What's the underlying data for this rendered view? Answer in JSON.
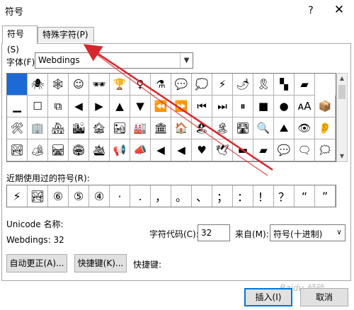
{
  "dialog": {
    "title": "符号",
    "help": "?",
    "close": "✕"
  },
  "tabs": [
    {
      "label": "符号(S)"
    },
    {
      "label": "特殊字符(P)"
    }
  ],
  "font": {
    "label": "字体(F):",
    "value": "Webdings"
  },
  "symbols": [
    [
      "",
      "🕷",
      "🕸",
      "☺",
      "🕶",
      "🏆",
      "♀",
      "⚗",
      "💬",
      "💭",
      "⚡",
      "🌶",
      "🎗",
      "▚",
      "▰"
    ],
    [
      "▁",
      "☐",
      "⧉",
      "◀",
      "▶",
      "▲",
      "▼",
      "⏪",
      "⏩",
      "⏮",
      "⏭",
      "⏸",
      "■",
      "●",
      "ᴀA",
      "📦"
    ],
    [
      "🛠",
      "🏢",
      "🏘",
      "🏙",
      "🏚",
      "🏜",
      "🏭",
      "🏛",
      "🏠",
      "🏖",
      "🏝",
      "🛣",
      "🔍",
      "⛰",
      "👁",
      "👂"
    ],
    [
      "🏞",
      "🏕",
      "🛤",
      "🏟",
      "🛳",
      "📢",
      "📣",
      "◀",
      "◀",
      "♥",
      "🕊",
      "▬",
      "▰",
      "💬",
      "🗨",
      "🗯"
    ]
  ],
  "recent": {
    "label": "近期使用过的符号(R):",
    "items": [
      "⚡",
      "🏞",
      "⑥",
      "⑤",
      "④",
      "·",
      ".",
      "，",
      "。",
      "、",
      "；",
      "：",
      "！",
      "？",
      "“",
      "”"
    ]
  },
  "unicode_name_label": "Unicode 名称:",
  "webdings_value": "Webdings: 32",
  "char_code": {
    "label": "字符代码(C):",
    "value": "32"
  },
  "from": {
    "label": "来自(M):",
    "value": "符号(十进制)"
  },
  "buttons": {
    "autocorrect": "自动更正(A)...",
    "shortcut_key": "快捷键(K)...",
    "insert": "插入(I)",
    "cancel": "取消"
  },
  "shortcut_label": "快捷键:",
  "watermark": "Baidu 经验",
  "colors": {
    "selected_cell": "#1c6ad6",
    "arrow": "#d9262c",
    "insert_border": "#0078d7"
  }
}
